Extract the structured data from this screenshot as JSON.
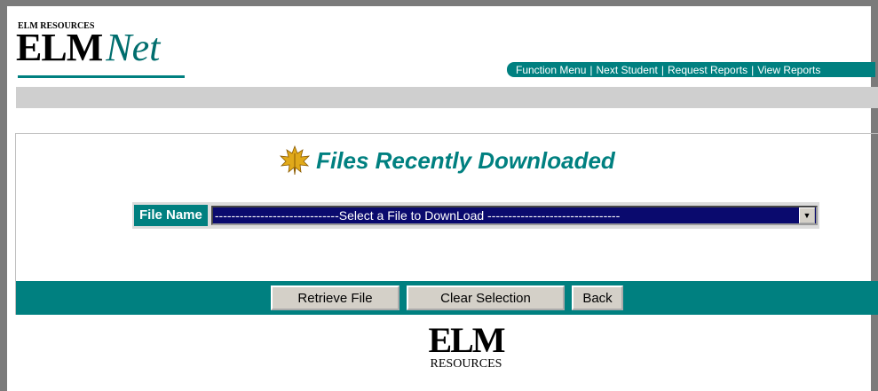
{
  "header": {
    "logo_small": "ELM RESOURCES",
    "logo_elm": "ELM",
    "logo_net": "Net",
    "nav": [
      {
        "label": "Function Menu"
      },
      {
        "label": "Next Student"
      },
      {
        "label": "Request Reports"
      },
      {
        "label": "View Reports"
      }
    ],
    "nav_separator": "|"
  },
  "main": {
    "title": "Files Recently Downloaded",
    "title_icon": "maple-leaf-icon",
    "file_label": "File Name",
    "file_select_value": "------------------------------Select a File to DownLoad --------------------------------",
    "buttons": {
      "retrieve": "Retrieve File",
      "clear": "Clear Selection",
      "back": "Back"
    }
  },
  "footer": {
    "logo_elm": "ELM",
    "logo_resources": "RESOURCES"
  },
  "colors": {
    "accent": "#008080",
    "frame": "#7b7b7b",
    "band": "#cfcfcf",
    "select_bg": "#0a0a6e"
  }
}
